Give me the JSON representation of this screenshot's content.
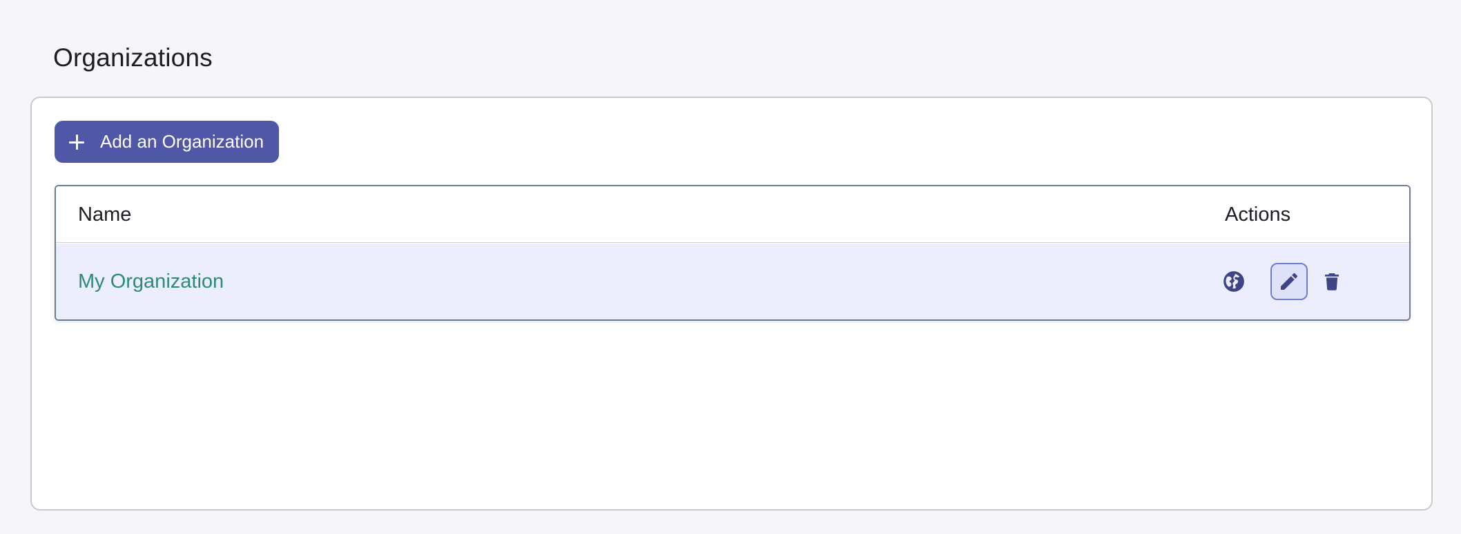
{
  "page": {
    "title": "Organizations"
  },
  "toolbar": {
    "add_label": "Add an Organization",
    "add_icon": "plus-icon"
  },
  "table": {
    "columns": [
      "Name",
      "Actions"
    ],
    "rows": [
      {
        "name": "My Organization",
        "actions": [
          "globe-icon",
          "edit-icon",
          "delete-icon"
        ]
      }
    ]
  },
  "colors": {
    "accent": "#5057a6",
    "link": "#2a8a7e",
    "row_highlight": "#eceefd",
    "icon": "#3d4585"
  }
}
